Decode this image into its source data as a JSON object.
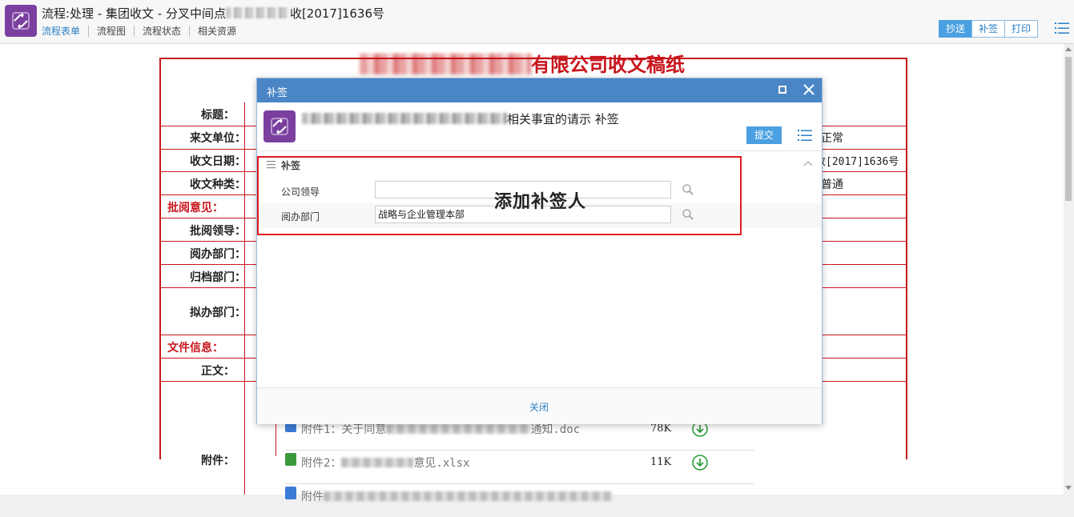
{
  "window": {
    "title_prefix": "流程:处理 - 集团收文 - 分叉中间点",
    "title_suffix": "收[2017]1636号"
  },
  "tabs": [
    "流程表单",
    "流程图",
    "流程状态",
    "相关资源"
  ],
  "top_actions": [
    "抄送",
    "补签",
    "打印"
  ],
  "document": {
    "title_suffix": "有限公司收文稿纸",
    "labels": {
      "title": "标题：",
      "sender": "来文单位：",
      "date": "收文日期：",
      "type": "收文种类：",
      "review_opinion": "批阅意见：",
      "review_leader": "批阅领导：",
      "handling_dept": "阅办部门：",
      "archive_dept": "归档部门：",
      "draft_dept": "拟办部门：",
      "file_info": "文件信息：",
      "body": "正文：",
      "attachments": "附件："
    },
    "values": {
      "urgency": "正常",
      "doc_no": "收[2017]1636号",
      "type": "普通"
    },
    "attachments": [
      {
        "prefix": "附件1：关于同意",
        "suffix": "通知.doc",
        "size": "78K",
        "kind": "doc"
      },
      {
        "prefix": "附件2：",
        "suffix": "意见.xlsx",
        "size": "11K",
        "kind": "xlsx"
      },
      {
        "prefix": "附件",
        "suffix": "",
        "size": "",
        "kind": "doc"
      }
    ]
  },
  "modal": {
    "title": "补签",
    "doc_title_suffix": "相关事宜的请示 补签",
    "submit_label": "提交",
    "section_title": "补签",
    "fields": [
      {
        "label": "公司领导",
        "value": ""
      },
      {
        "label": "阅办部门",
        "value": "战略与企业管理本部"
      }
    ],
    "close_label": "关闭"
  },
  "annotation": "添加补签人",
  "colors": {
    "accent_blue": "#4a86c6",
    "brand_purple": "#7b3fa0",
    "form_red": "#c8161d",
    "annotation_red": "#e0191f"
  }
}
